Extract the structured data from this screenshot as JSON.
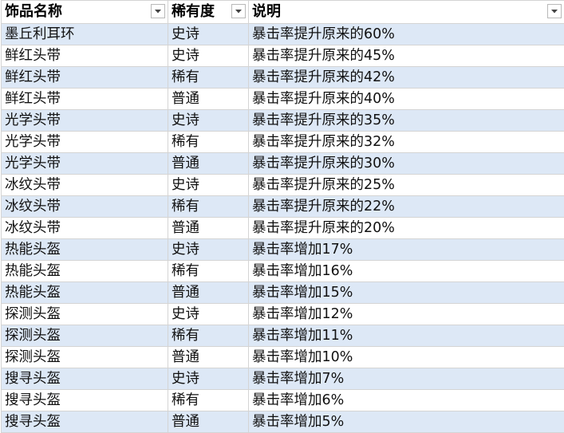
{
  "header": {
    "col_name": "饰品名称",
    "col_rarity": "稀有度",
    "col_desc": "说明",
    "filter_icon": "dropdown-arrow-icon"
  },
  "rows": [
    {
      "name": "墨丘利耳环",
      "rarity": "史诗",
      "desc": "暴击率提升原来的60%"
    },
    {
      "name": "鲜红头带",
      "rarity": "史诗",
      "desc": "暴击率提升原来的45%"
    },
    {
      "name": "鲜红头带",
      "rarity": "稀有",
      "desc": "暴击率提升原来的42%"
    },
    {
      "name": "鲜红头带",
      "rarity": "普通",
      "desc": "暴击率提升原来的40%"
    },
    {
      "name": "光学头带",
      "rarity": "史诗",
      "desc": "暴击率提升原来的35%"
    },
    {
      "name": "光学头带",
      "rarity": "稀有",
      "desc": "暴击率提升原来的32%"
    },
    {
      "name": "光学头带",
      "rarity": "普通",
      "desc": "暴击率提升原来的30%"
    },
    {
      "name": "冰纹头带",
      "rarity": "史诗",
      "desc": "暴击率提升原来的25%"
    },
    {
      "name": "冰纹头带",
      "rarity": "稀有",
      "desc": "暴击率提升原来的22%"
    },
    {
      "name": "冰纹头带",
      "rarity": "普通",
      "desc": "暴击率提升原来的20%"
    },
    {
      "name": "热能头盔",
      "rarity": "史诗",
      "desc": "暴击率增加17%"
    },
    {
      "name": "热能头盔",
      "rarity": "稀有",
      "desc": "暴击率增加16%"
    },
    {
      "name": "热能头盔",
      "rarity": "普通",
      "desc": "暴击率增加15%"
    },
    {
      "name": "探测头盔",
      "rarity": "史诗",
      "desc": "暴击率增加12%"
    },
    {
      "name": "探测头盔",
      "rarity": "稀有",
      "desc": "暴击率增加11%"
    },
    {
      "name": "探测头盔",
      "rarity": "普通",
      "desc": "暴击率增加10%"
    },
    {
      "name": "搜寻头盔",
      "rarity": "史诗",
      "desc": "暴击率增加7%"
    },
    {
      "name": "搜寻头盔",
      "rarity": "稀有",
      "desc": "暴击率增加6%"
    },
    {
      "name": "搜寻头盔",
      "rarity": "普通",
      "desc": "暴击率增加5%"
    }
  ],
  "colors": {
    "band_row": "#dde8f6",
    "plain_row": "#ffffff",
    "grid_line": "#d4d4d4"
  }
}
